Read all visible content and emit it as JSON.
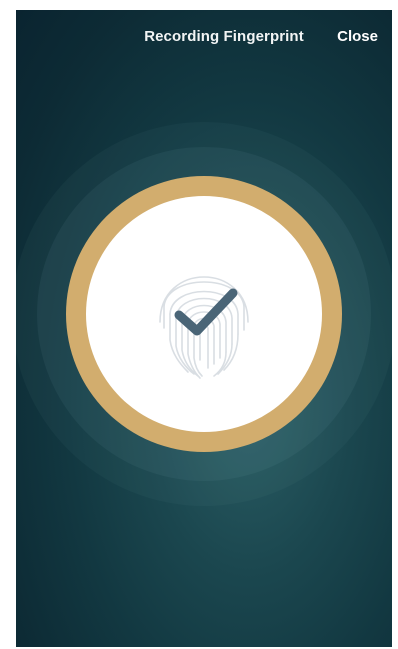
{
  "header": {
    "title": "Recording Fingerprint",
    "close_label": "Close"
  },
  "scan": {
    "status": "success",
    "icons": [
      "fingerprint-icon",
      "checkmark-icon"
    ]
  },
  "colors": {
    "background_dark": "#0a2430",
    "background_mid": "#1b474f",
    "ring_gold": "#d2ad6e",
    "disc_white": "#ffffff",
    "checkmark": "#4a6577",
    "fingerprint_lines": "#d9dee3"
  }
}
